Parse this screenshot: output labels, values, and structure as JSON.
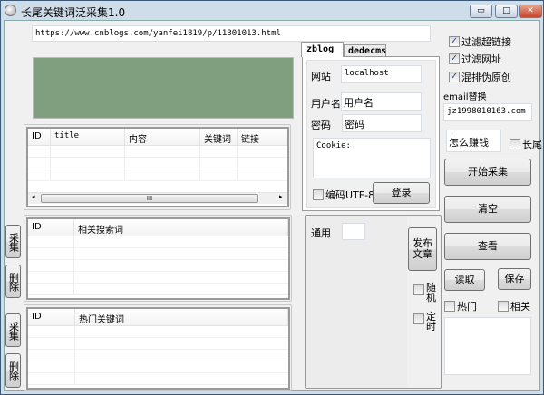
{
  "window": {
    "title": "长尾关键词泛采集1.0",
    "minimize": "▭",
    "maximize": "□",
    "close": "✕"
  },
  "url_input": {
    "value": "https://www.cnblogs.com/yanfei1819/p/11301013.html"
  },
  "colors": {
    "green_panel": "#7f9f7f"
  },
  "tables": {
    "articles": {
      "columns": [
        "ID",
        "title",
        "内容",
        "关键词",
        "链接"
      ],
      "scroll_grip": "III"
    },
    "related": {
      "columns": [
        "ID",
        "相关搜索词"
      ]
    },
    "hot": {
      "columns": [
        "ID",
        "热门关键词"
      ]
    }
  },
  "side_buttons": {
    "collect1": "采集",
    "delete1": "删除",
    "collect2": "采集",
    "delete2": "删除"
  },
  "tabs": [
    {
      "label": "zblog"
    },
    {
      "label": "dedecms"
    }
  ],
  "zblog": {
    "site_label": "网站",
    "site_value": "localhost",
    "user_label": "用户名",
    "user_value": "用户名",
    "pass_label": "密码",
    "pass_value": "密码",
    "cookie_value": "Cookie:",
    "utf8_label": "编码UTF-8",
    "login": "登录"
  },
  "publish": {
    "general_label": "通用",
    "general_value": "",
    "publish_button": "发布文章",
    "random_label": "随机",
    "timed_label": "定时"
  },
  "options": {
    "filter_links": "过滤超链接",
    "filter_urls": "过滤网址",
    "mix_pseudo": "混排伪原创",
    "email_label": "email替换",
    "email_value": "jz1998010163.com",
    "keyword_value": "怎么赚钱",
    "longtail_label": "长尾"
  },
  "buttons": {
    "start": "开始采集",
    "clear": "清空",
    "view": "查看",
    "read": "读取",
    "save": "保存"
  },
  "bottom_checks": {
    "hot": "热门",
    "related": "相关"
  },
  "notes_area": {
    "value": ""
  }
}
